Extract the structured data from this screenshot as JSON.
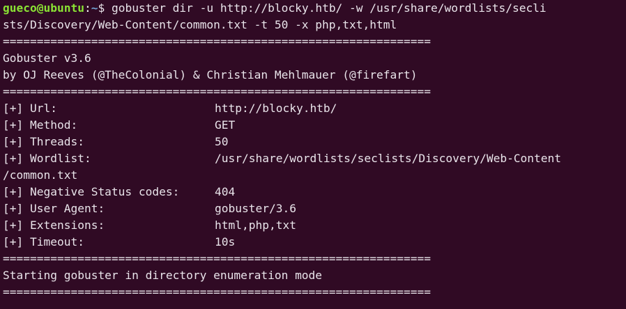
{
  "prompt": {
    "user_host": "gueco@ubuntu",
    "separator": ":",
    "path": "~",
    "symbol": "$ ",
    "command_line1": "gobuster dir -u http://blocky.htb/ -w /usr/share/wordlists/secli",
    "command_line2": "sts/Discovery/Web-Content/common.txt -t 50 -x php,txt,html"
  },
  "divider": "===============================================================",
  "banner": {
    "title": "Gobuster v3.6",
    "authors": "by OJ Reeves (@TheColonial) & Christian Mehlmauer (@firefart)"
  },
  "config": [
    {
      "key": "[+] Url:",
      "value": "http://blocky.htb/"
    },
    {
      "key": "[+] Method:",
      "value": "GET"
    },
    {
      "key": "[+] Threads:",
      "value": "50"
    },
    {
      "key": "[+] Wordlist:",
      "value": "/usr/share/wordlists/seclists/Discovery/Web-Content"
    },
    {
      "key": "/common.txt",
      "value": ""
    },
    {
      "key": "[+] Negative Status codes:",
      "value": "404"
    },
    {
      "key": "[+] User Agent:",
      "value": "gobuster/3.6"
    },
    {
      "key": "[+] Extensions:",
      "value": "html,php,txt"
    },
    {
      "key": "[+] Timeout:",
      "value": "10s"
    }
  ],
  "status_message": "Starting gobuster in directory enumeration mode"
}
